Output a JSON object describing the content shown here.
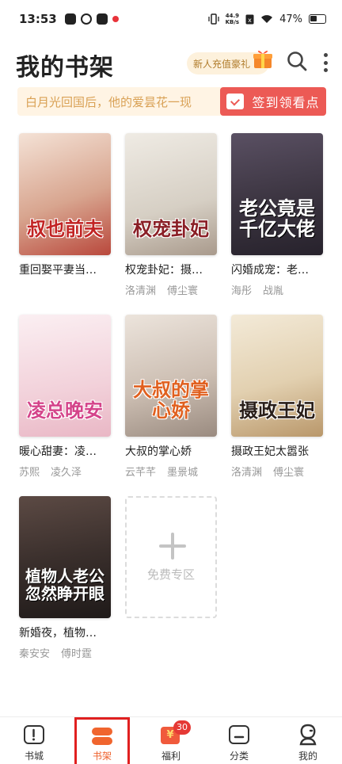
{
  "status_bar": {
    "time": "13:53",
    "net_speed_value": "44.9",
    "net_speed_unit": "KB/s",
    "battery": "47%"
  },
  "header": {
    "title": "我的书架",
    "promo": "新人充值豪礼"
  },
  "banner": {
    "text": "白月光回国后，他的爱昙花一现",
    "checkin": "签到领看点"
  },
  "books": [
    {
      "title": "重回娶平妻当…",
      "authors": [],
      "cover_text": "叔也前夫",
      "cover_color": "#e9c9b8"
    },
    {
      "title": "权宠卦妃：摄…",
      "authors": [
        "洛清渊",
        "傅尘寰"
      ],
      "cover_text": "权宠卦妃",
      "cover_color": "#e6e1da"
    },
    {
      "title": "闪婚成宠：老…",
      "authors": [
        "海彤",
        "战胤"
      ],
      "cover_text": "老公竟是千亿大佬",
      "cover_color": "#40384a"
    },
    {
      "title": "暖心甜妻：凌…",
      "authors": [
        "苏熙",
        "凌久泽"
      ],
      "cover_text": "凌总晚安",
      "cover_color": "#f6dfe4"
    },
    {
      "title": "大叔的掌心娇",
      "authors": [
        "云芊芊",
        "墨景城"
      ],
      "cover_text": "大叔的掌心娇",
      "cover_color": "#d9cfc6"
    },
    {
      "title": "摄政王妃太嚣张",
      "authors": [
        "洛清渊",
        "傅尘寰"
      ],
      "cover_text": "摄政王妃",
      "cover_color": "#e7dcc7"
    },
    {
      "title": "新婚夜，植物…",
      "authors": [
        "秦安安",
        "傅时霆"
      ],
      "cover_text": "植物人老公忽然睁开眼",
      "cover_color": "#3a2f2c"
    }
  ],
  "add_tile": {
    "label": "免费专区"
  },
  "nav": [
    {
      "label": "书城"
    },
    {
      "label": "书架"
    },
    {
      "label": "福利",
      "badge": "30",
      "icon_text": "¥"
    },
    {
      "label": "分类"
    },
    {
      "label": "我的"
    }
  ]
}
